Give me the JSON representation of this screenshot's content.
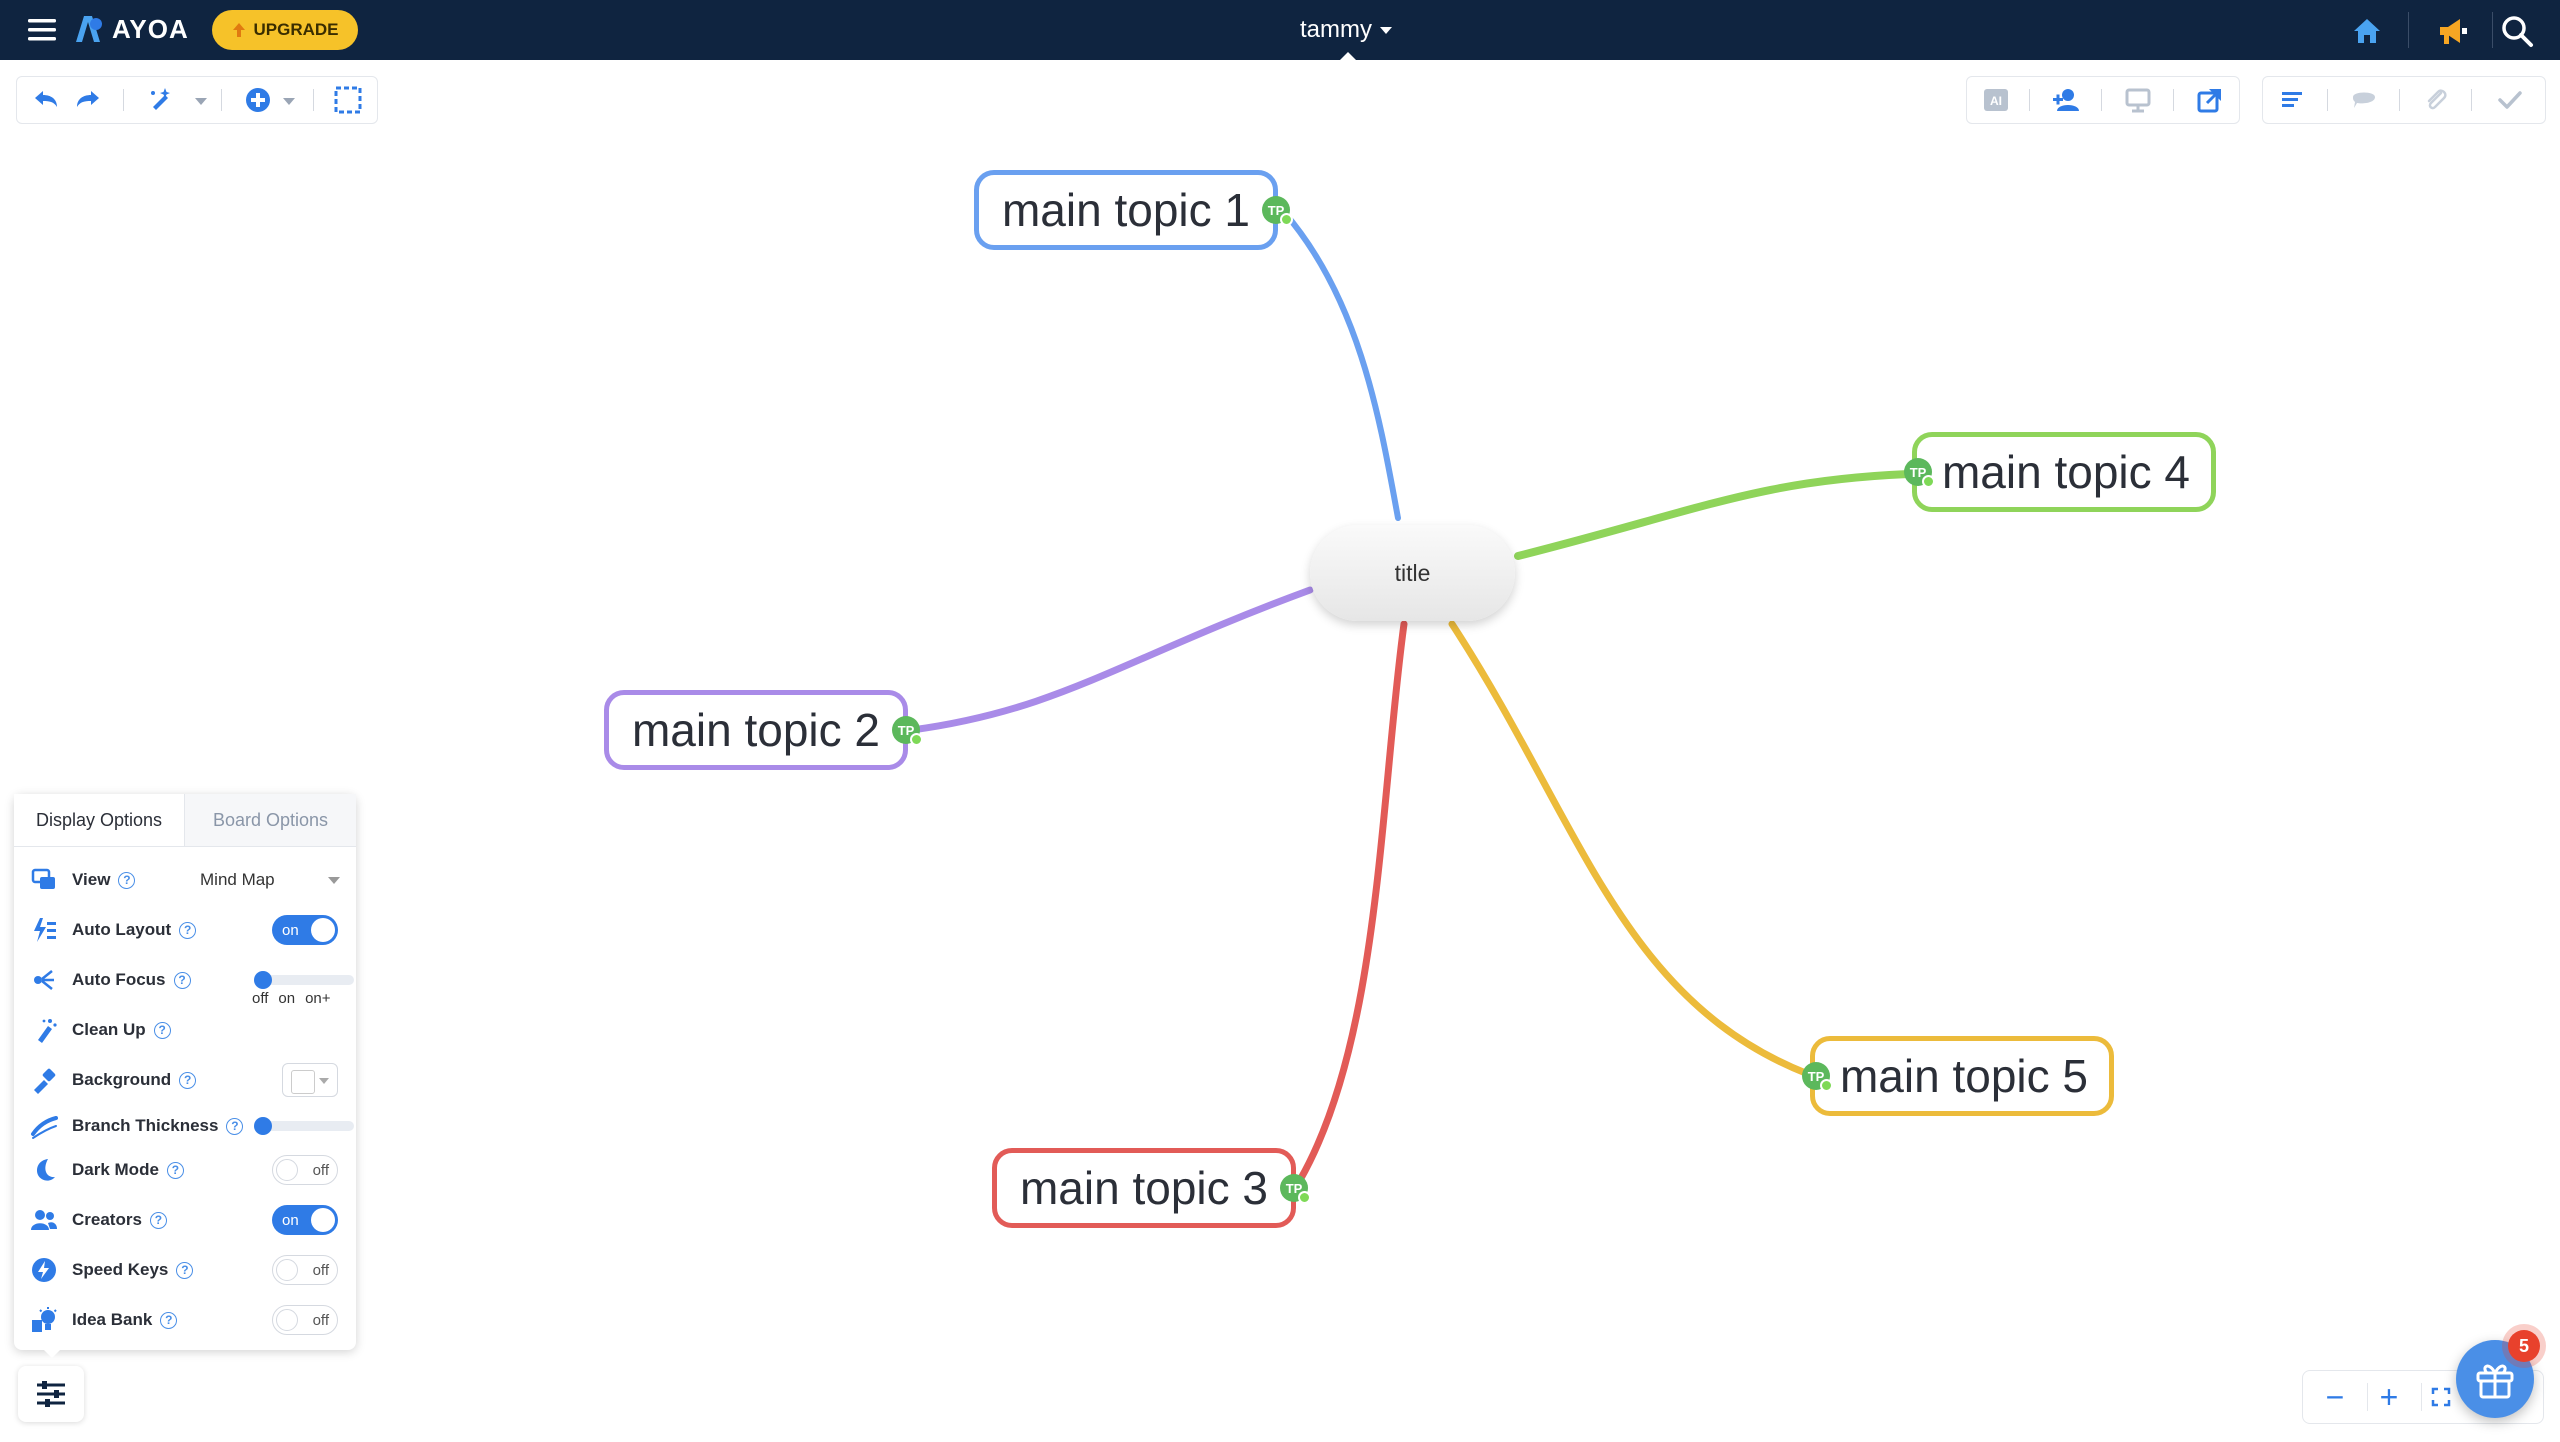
{
  "app": {
    "name": "AYOA",
    "upgrade_label": "UPGRADE",
    "user": "tammy"
  },
  "colors": {
    "topbar": "#0f2440",
    "accent": "#2f7be6",
    "upgrade": "#f6c229"
  },
  "icons": {
    "topbar": [
      "menu-icon",
      "ayoa-logo-icon",
      "home-icon",
      "megaphone-icon",
      "search-icon"
    ],
    "toolbar_left": [
      "undo-icon",
      "redo-icon",
      "magic-wand-icon",
      "add-icon",
      "select-area-icon"
    ],
    "toolbar_right": [
      "ai-icon",
      "add-user-icon",
      "present-icon",
      "share-icon",
      "list-icon",
      "comment-icon",
      "attachment-icon",
      "check-icon"
    ]
  },
  "mindmap": {
    "central": {
      "label": "title"
    },
    "topics": [
      {
        "label": "main topic 1",
        "color": "#6aa0f0",
        "badge": "TP"
      },
      {
        "label": "main topic 2",
        "color": "#a98be8",
        "badge": "TP"
      },
      {
        "label": "main topic 3",
        "color": "#e25b57",
        "badge": "TP"
      },
      {
        "label": "main topic 4",
        "color": "#8fd45a",
        "badge": "TP"
      },
      {
        "label": "main topic 5",
        "color": "#ecbb3b",
        "badge": "TP"
      }
    ]
  },
  "panel": {
    "tabs": [
      "Display Options",
      "Board Options"
    ],
    "view": {
      "label": "View",
      "value": "Mind Map"
    },
    "auto_layout": {
      "label": "Auto Layout",
      "state": "on"
    },
    "auto_focus": {
      "label": "Auto Focus",
      "levels": [
        "off",
        "on",
        "on+"
      ]
    },
    "clean_up": {
      "label": "Clean Up"
    },
    "background": {
      "label": "Background"
    },
    "branch_thickness": {
      "label": "Branch Thickness"
    },
    "dark_mode": {
      "label": "Dark Mode",
      "state": "off"
    },
    "creators": {
      "label": "Creators",
      "state": "on"
    },
    "speed_keys": {
      "label": "Speed Keys",
      "state": "off"
    },
    "idea_bank": {
      "label": "Idea Bank",
      "state": "off"
    },
    "help_glyph": "?"
  },
  "zoom": {
    "minus": "−",
    "plus": "+"
  },
  "gift": {
    "badge_count": "5"
  }
}
